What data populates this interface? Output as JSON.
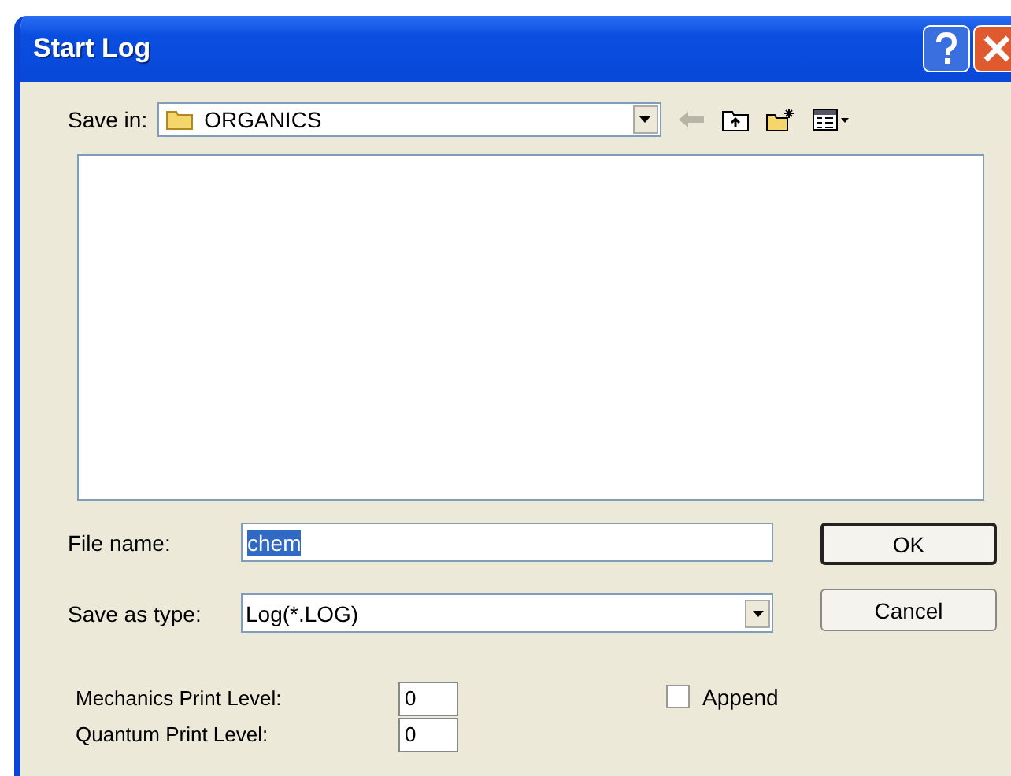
{
  "window": {
    "title": "Start Log"
  },
  "save_in": {
    "label": "Save in:",
    "value": "ORGANICS"
  },
  "file_name": {
    "label": "File name:",
    "value": "chem",
    "selected": true
  },
  "save_as_type": {
    "label": "Save as type:",
    "value": "Log(*.LOG)"
  },
  "buttons": [
    {
      "label": "OK",
      "default": true
    },
    {
      "label": "Cancel",
      "default": false
    }
  ],
  "print_levels": [
    {
      "label": "Mechanics Print Level:",
      "value": "0"
    },
    {
      "label": "Quantum Print Level:",
      "value": "0"
    }
  ],
  "append": {
    "label": "Append",
    "checked": false
  }
}
